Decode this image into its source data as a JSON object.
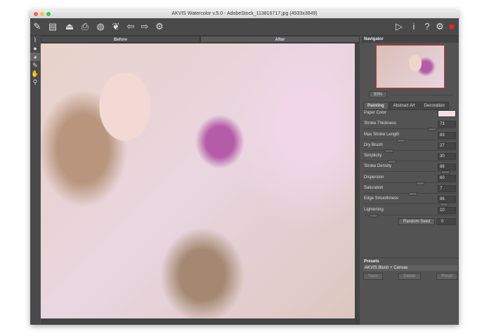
{
  "window": {
    "title": "AKVIS Watercolor v.5.0 - AdobeStock_113816717.jpg (4933x3849)"
  },
  "toolbar": {
    "left": [
      "brush-logo-icon",
      "open-icon",
      "save-icon",
      "print-icon",
      "import-icon",
      "share-icon",
      "undo-icon",
      "redo-icon",
      "settings-gear-icon"
    ],
    "right": [
      "run-icon",
      "info-icon",
      "help-icon",
      "preferences-icon",
      "display-icon"
    ]
  },
  "tools": [
    "brush-tool-icon",
    "drop-tool-icon",
    "paint-tool-icon",
    "pencil-tool-icon",
    "hand-tool-icon",
    "zoom-tool-icon"
  ],
  "view_tabs": {
    "before": "Before",
    "after": "After",
    "active": "After"
  },
  "navigator": {
    "title": "Navigator",
    "zoom": "50%"
  },
  "painting": {
    "tabs": [
      "Painting",
      "Abstract Art",
      "Decoration"
    ],
    "paper_color_label": "Paper Color",
    "paper_color": "#f3e1e1",
    "params": [
      {
        "label": "Stroke Thickness",
        "value": "73",
        "fraction": 0.73
      },
      {
        "label": "Max Stroke Length",
        "value": "83",
        "fraction": 0.4
      },
      {
        "label": "Dry Brush",
        "value": "27",
        "fraction": 0.27
      },
      {
        "label": "Simplicity",
        "value": "30",
        "fraction": 0.3
      },
      {
        "label": "Stroke Density",
        "value": "88",
        "fraction": 0.88
      },
      {
        "label": "Dispersion",
        "value": "60",
        "fraction": 0.6
      },
      {
        "label": "Saturation",
        "value": "7",
        "fraction": 0.53
      },
      {
        "label": "Edge Smoothness",
        "value": "86",
        "fraction": 0.86
      },
      {
        "label": "Lightening",
        "value": "10",
        "fraction": 0.1
      }
    ],
    "random_seed_label": "Random Seed",
    "random_seed": "0"
  },
  "presets": {
    "title": "Presets",
    "selected": "AKVIS Blush + Canvas",
    "save": "Save",
    "delete": "Delete",
    "reset": "Reset"
  }
}
